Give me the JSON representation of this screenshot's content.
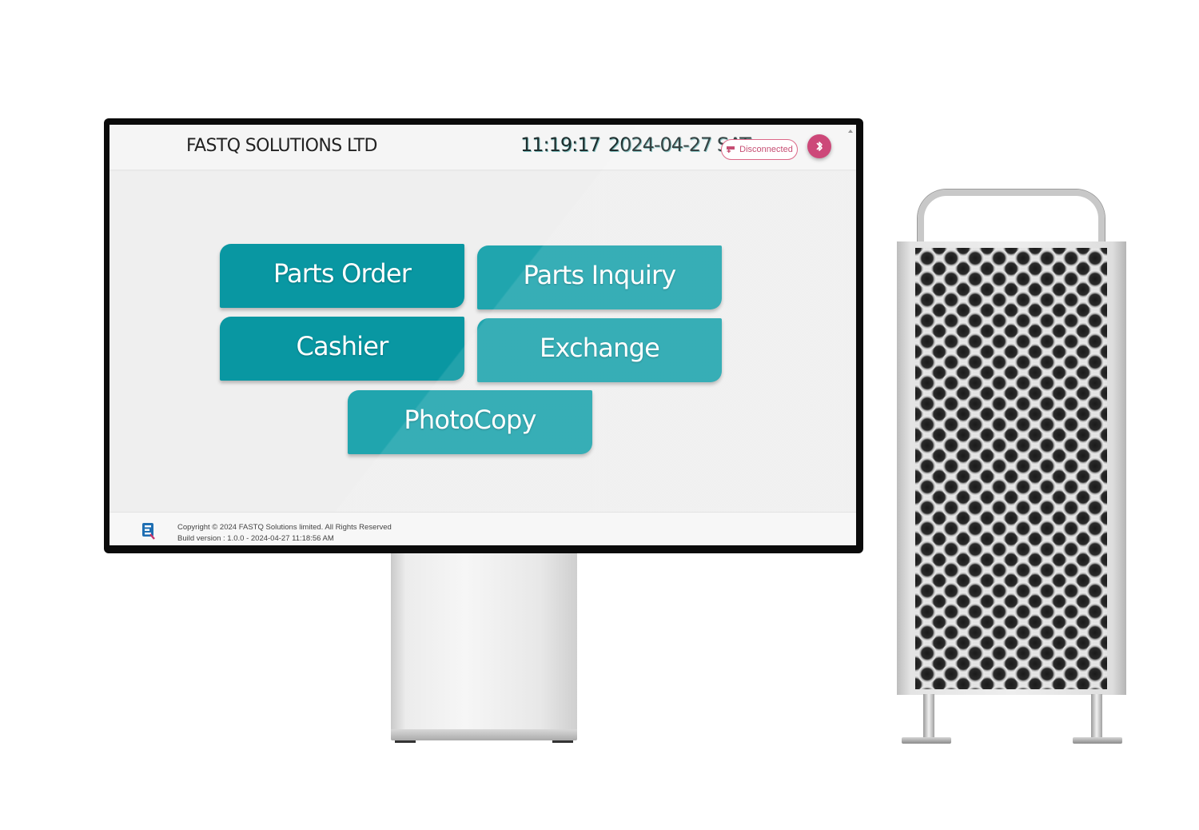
{
  "header": {
    "company": "FASTQ SOLUTIONS LTD",
    "time": "11:19:17",
    "date": "2024-04-27 SAT",
    "status": "Disconnected"
  },
  "menu": {
    "parts_order": "Parts Order",
    "parts_inquiry": "Parts Inquiry",
    "cashier": "Cashier",
    "exchange": "Exchange",
    "photocopy": "PhotoCopy"
  },
  "footer": {
    "copyright": "Copyright © 2024 FASTQ Solutions limited. All Rights Reserved",
    "build": "Build version : 1.0.0 - 2024-04-27 11:18:56 AM"
  },
  "icons": {
    "status": "printer-icon",
    "bluetooth": "bluetooth-icon",
    "logo": "fastq-logo-icon"
  },
  "colors": {
    "accent": "#0997a2",
    "status": "#c7336a"
  }
}
